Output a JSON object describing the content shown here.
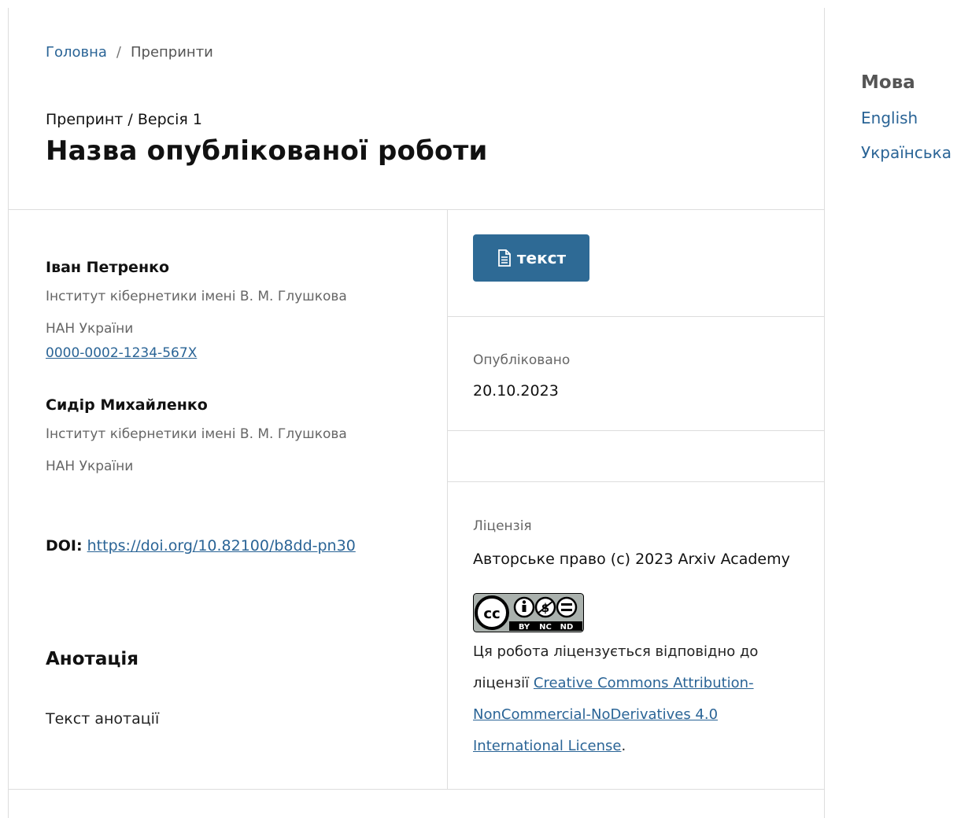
{
  "breadcrumb": {
    "home": "Головна",
    "separator": "/",
    "current": "Препринти"
  },
  "header": {
    "kicker": "Препринт / Версія 1",
    "title": "Назва опублікованої роботи"
  },
  "authors": [
    {
      "name": "Іван Петренко",
      "affiliation_line1": "Інститут кібернетики імені В. М. Глушкова",
      "affiliation_line2": "НАН України",
      "orcid": "0000-0002-1234-567X"
    },
    {
      "name": "Сидір Михайленко",
      "affiliation_line1": "Інститут кібернетики імені В. М. Глушкова",
      "affiliation_line2": "НАН України"
    }
  ],
  "doi": {
    "label": "DOI:",
    "url": "https://doi.org/10.82100/b8dd-pn30"
  },
  "abstract": {
    "heading": "Анотація",
    "text": "Текст анотації"
  },
  "galley": {
    "button_label": "текст",
    "icon": "file-text-icon"
  },
  "published": {
    "label": "Опубліковано",
    "date": "20.10.2023"
  },
  "license": {
    "label": "Ліцензія",
    "copyright": "Авторське право (c) 2023 Arxiv Academy",
    "badge": {
      "cc": "cc",
      "terms": [
        "BY",
        "NC",
        "ND"
      ]
    },
    "text_before": "Ця робота ліцензується відповідно до ліцензії ",
    "link_text": "Creative Commons Attribution-NonCommercial-NoDerivatives 4.0 International License",
    "text_after": "."
  },
  "sidebar": {
    "heading": "Мова",
    "languages": [
      "English",
      "Українська"
    ]
  },
  "colors": {
    "link": "#2a6496",
    "button": "#2e6a95",
    "muted": "#666666",
    "border": "#dddddd"
  }
}
